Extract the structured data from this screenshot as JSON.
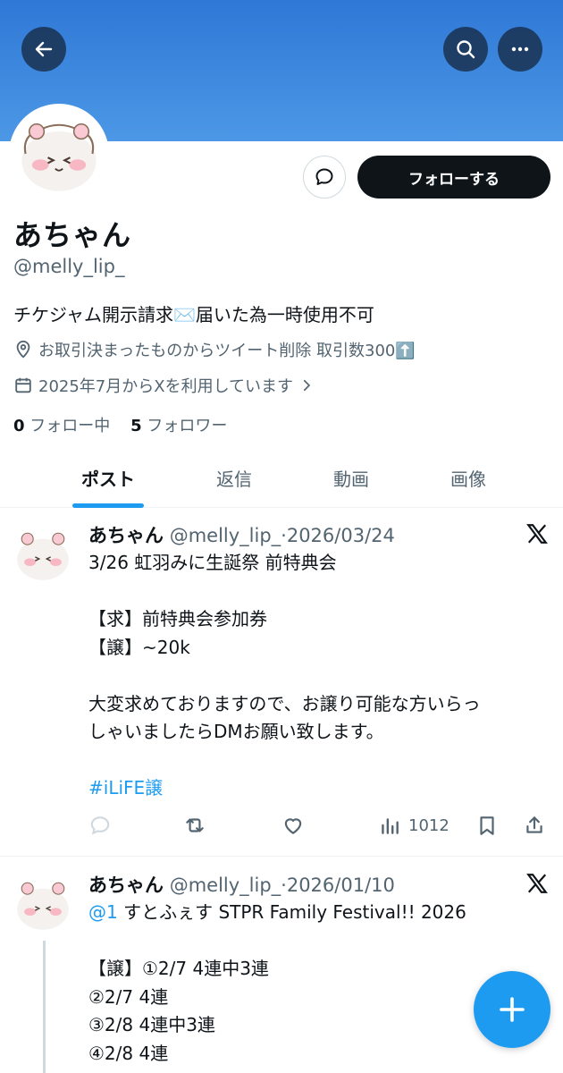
{
  "profile": {
    "follow_label": "フォローする",
    "name": "あちゃん",
    "handle": "@melly_lip_",
    "bio": "チケジャム開示請求✉️届いた為一時使用不可",
    "location": "お取引決まったものからツイート削除 取引数300⬆️",
    "joined": "2025年7月からXを利用しています",
    "following_count": "0",
    "following_label": "フォロー中",
    "followers_count": "5",
    "followers_label": "フォロワー"
  },
  "tabs": [
    "ポスト",
    "返信",
    "動画",
    "画像"
  ],
  "posts": [
    {
      "name": "あちゃん",
      "meta": "@melly_lip_·2026/03/24",
      "lines": [
        "3/26 虹羽みに生誕祭 前特典会",
        "",
        "【求】前特典会参加券",
        "【譲】~20k",
        "",
        "大変求めておりますので、お譲り可能な方いらっ",
        "しゃいましたらDMお願い致します。",
        ""
      ],
      "hashtag": "#iLiFE譲",
      "views": "1012"
    },
    {
      "name": "あちゃん",
      "meta": "@melly_lip_·2026/01/10",
      "mention": "@1",
      "first_line": " すとふぇす STPR Family Festival!! 2026",
      "lines": [
        "",
        "【譲】①2/7 4連中3連",
        "②2/7 4連",
        "③2/8  4連中3連",
        "④2/8 4連"
      ]
    }
  ],
  "colors": {
    "banner": "#3b86de",
    "accent": "#1d9bf0",
    "text": "#0f1419",
    "secondary": "#536471"
  },
  "icons": [
    "back-arrow-icon",
    "search-icon",
    "more-icon",
    "message-icon",
    "location-pin-icon",
    "calendar-icon",
    "chevron-right-icon",
    "x-logo-icon",
    "reply-icon",
    "repost-icon",
    "like-icon",
    "views-icon",
    "bookmark-icon",
    "share-icon",
    "compose-plus-icon"
  ]
}
